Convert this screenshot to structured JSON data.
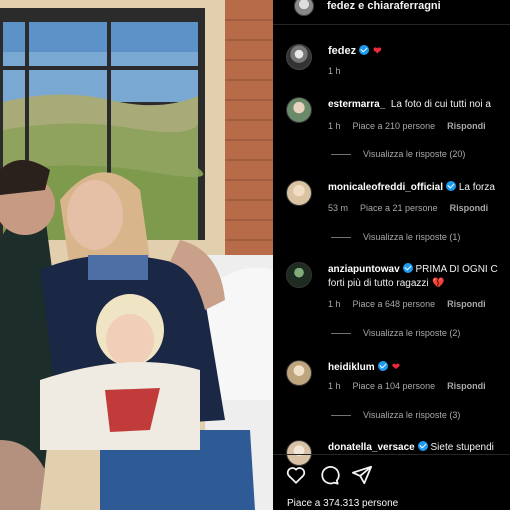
{
  "post": {
    "header_title": "fedez e chiaraferragni",
    "caption_user": "fedez",
    "caption_time": "1 h",
    "likes": "Piace a 374.313 persone"
  },
  "comments": [
    {
      "user": "estermarra_",
      "text": "La foto di cui tutti noi a",
      "time": "1 h",
      "likes": "Piace a 210 persone",
      "reply": "Rispondi",
      "replies": "Visualizza le risposte (20)",
      "verified": false
    },
    {
      "user": "monicaleofreddi_official",
      "text": "La forza",
      "time": "53 m",
      "likes": "Piace a 21 persone",
      "reply": "Rispondi",
      "replies": "Visualizza le risposte (1)",
      "verified": true
    },
    {
      "user": "anziapuntowav",
      "text": "PRIMA DI OGNI C",
      "text2": "forti più di tutto ragazzi",
      "time": "1 h",
      "likes": "Piace a 648 persone",
      "reply": "Rispondi",
      "replies": "Visualizza le risposte (2)",
      "verified": true
    },
    {
      "user": "heidiklum",
      "text": "",
      "time": "1 h",
      "likes": "Piace a 104 persone",
      "reply": "Rispondi",
      "replies": "Visualizza le risposte (3)",
      "verified": true
    },
    {
      "user": "donatella_versace",
      "text": "Siete stupendi",
      "verified": true
    }
  ],
  "icons": [
    "heart-icon",
    "comment-icon",
    "share-icon",
    "verified-icon",
    "red-heart-icon",
    "broken-heart-icon"
  ],
  "colors": {
    "background": "#000000",
    "verified": "#1d9bf0",
    "heart": "#ed2b3b",
    "muted_text": "#a8a8a8"
  }
}
